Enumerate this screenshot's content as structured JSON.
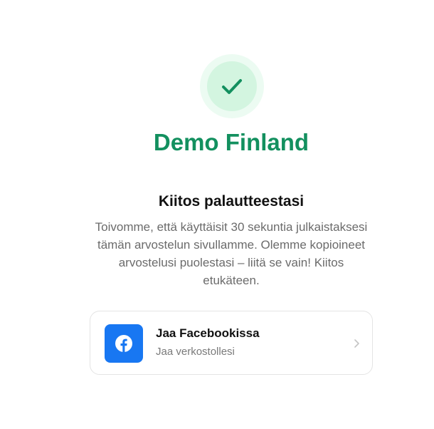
{
  "brand": {
    "name": "Demo Finland",
    "color": "#13905f",
    "check_icon": "checkmark-icon"
  },
  "feedback": {
    "heading": "Kiitos palautteestasi",
    "message": "Toivomme, että käyttäisit 30 sekuntia julkaistaksesi tämän arvostelun sivullamme. Olemme kopioineet arvostelusi puolestasi – liitä se vain! Kiitos etukäteen."
  },
  "share": {
    "facebook": {
      "title": "Jaa Facebookissa",
      "subtitle": "Jaa verkostollesi",
      "icon": "facebook-icon",
      "color": "#1877f2"
    }
  }
}
